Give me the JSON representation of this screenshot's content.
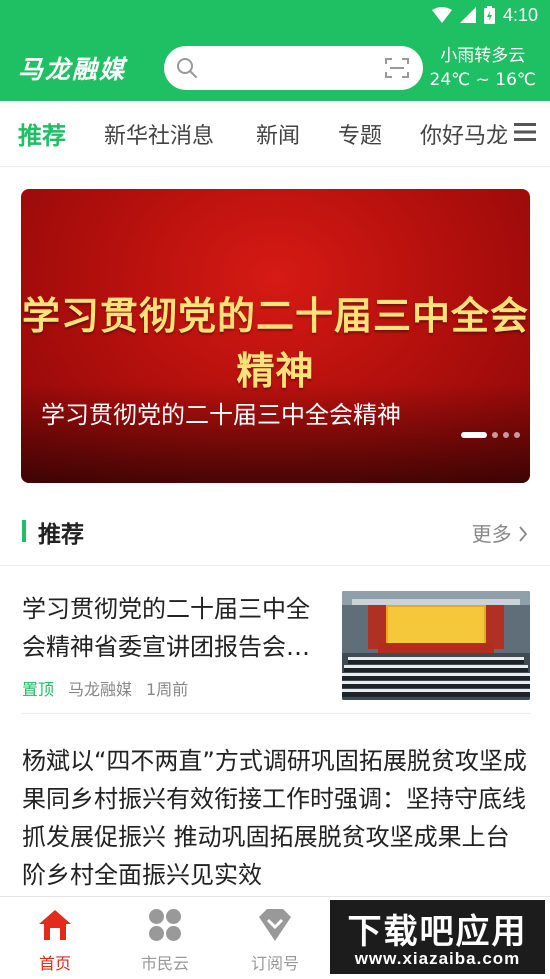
{
  "status_bar": {
    "time": "4:10"
  },
  "header": {
    "logo": "马龙融媒",
    "search": {
      "placeholder": ""
    },
    "weather": {
      "condition": "小雨转多云",
      "temperature": "24℃ ~ 16℃"
    }
  },
  "tabs": [
    {
      "label": "推荐",
      "active": true
    },
    {
      "label": "新华社消息",
      "active": false
    },
    {
      "label": "新闻",
      "active": false
    },
    {
      "label": "专题",
      "active": false
    },
    {
      "label": "你好马龙",
      "active": false
    }
  ],
  "banner": {
    "headline": "学习贯彻党的二十届三中全会精神",
    "caption": "学习贯彻党的二十届三中全会精神",
    "slide_count": 4,
    "current_slide": 1
  },
  "section": {
    "title": "推荐",
    "more": "更多"
  },
  "news": [
    {
      "title": "学习贯彻党的二十届三中全会精神省委宣讲团报告会…",
      "tag": "置顶",
      "source": "马龙融媒",
      "time": "1周前",
      "thumbnail": "auditorium-photo"
    },
    {
      "title": "杨斌以“四不两直”方式调研巩固拓展脱贫攻坚成果同乡村振兴有效衔接工作时强调：坚持守底线抓发展促振兴 推动巩固拓展脱贫攻坚成果上台阶乡村全面振兴见实效"
    }
  ],
  "bottom_nav": [
    {
      "label": "首页",
      "icon": "home-icon",
      "active": true
    },
    {
      "label": "市民云",
      "icon": "clover-icon",
      "active": false
    },
    {
      "label": "订阅号",
      "icon": "subscribe-icon",
      "active": false
    }
  ],
  "watermark": {
    "line1": "下载吧应用",
    "line2": "www.xiazaiba.com"
  },
  "colors": {
    "brand": "#1fbf63",
    "banner_red": "#c4120e",
    "nav_active": "#e02b1d"
  }
}
